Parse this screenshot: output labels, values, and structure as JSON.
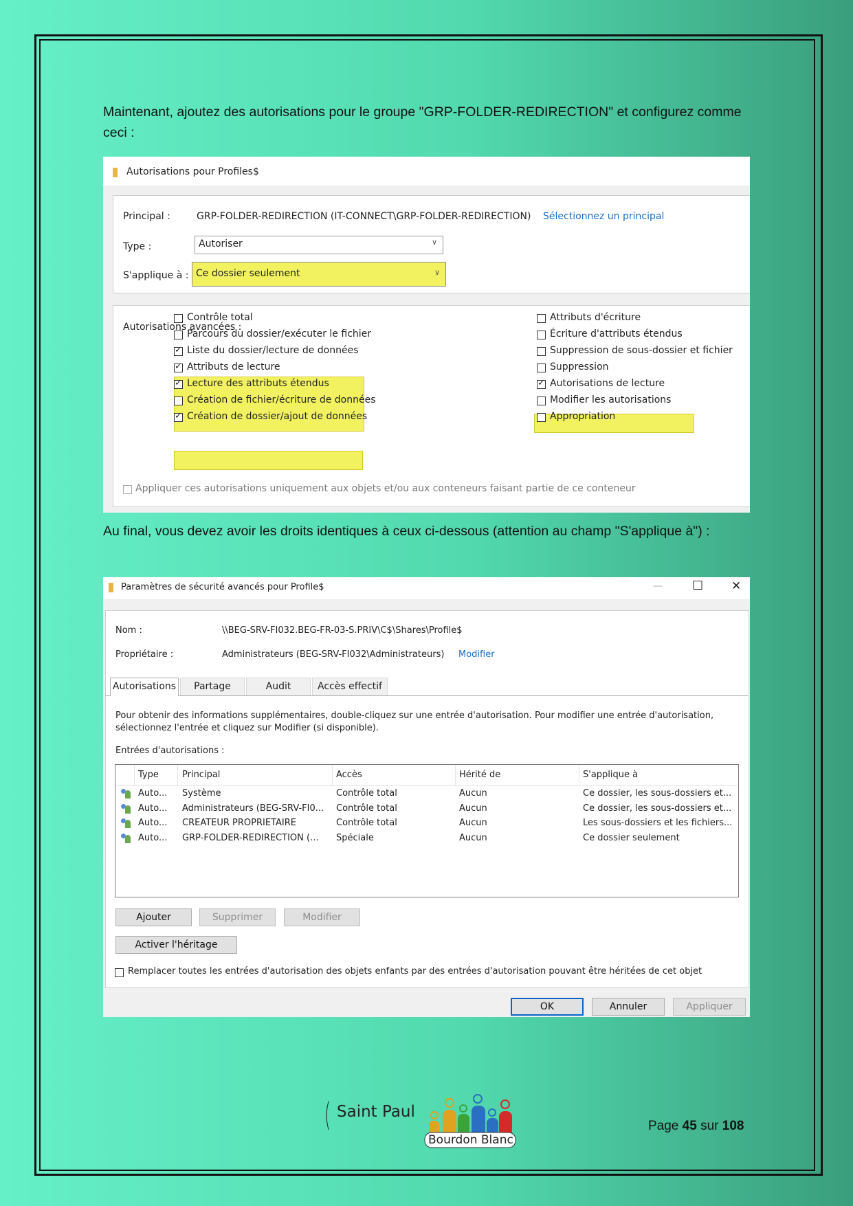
{
  "intro_text": "Maintenant, ajoutez des autorisations pour le groupe \"GRP-FOLDER-REDIRECTION\" et configurez comme ceci :",
  "between_text": "Au final, vous devez avoir les droits identiques à ceux ci-dessous (attention au champ \"S'applique à\") :",
  "dialog1": {
    "title": "Autorisations pour Profiles$",
    "principal_label": "Principal :",
    "principal_value": "GRP-FOLDER-REDIRECTION (IT-CONNECT\\GRP-FOLDER-REDIRECTION)",
    "principal_link": "Sélectionnez un principal",
    "type_label": "Type :",
    "type_value": "Autoriser",
    "applies_label": "S'applique à :",
    "applies_value": "Ce dossier seulement",
    "advanced_label": "Autorisations avancées :",
    "perms_left": [
      {
        "label": "Contrôle total",
        "checked": false,
        "highlighted": false
      },
      {
        "label": "Parcours du dossier/exécuter le fichier",
        "checked": false,
        "highlighted": false
      },
      {
        "label": "Liste du dossier/lecture de données",
        "checked": true,
        "highlighted": true
      },
      {
        "label": "Attributs de lecture",
        "checked": true,
        "highlighted": true
      },
      {
        "label": "Lecture des attributs étendus",
        "checked": true,
        "highlighted": true
      },
      {
        "label": "Création de fichier/écriture de données",
        "checked": false,
        "highlighted": false
      },
      {
        "label": "Création de dossier/ajout de données",
        "checked": true,
        "highlighted": true
      }
    ],
    "perms_right": [
      {
        "label": "Attributs d'écriture",
        "checked": false,
        "highlighted": false
      },
      {
        "label": "Écriture d'attributs étendus",
        "checked": false,
        "highlighted": false
      },
      {
        "label": "Suppression de sous-dossier et fichier",
        "checked": false,
        "highlighted": false
      },
      {
        "label": "Suppression",
        "checked": false,
        "highlighted": false
      },
      {
        "label": "Autorisations de lecture",
        "checked": true,
        "highlighted": true
      },
      {
        "label": "Modifier les autorisations",
        "checked": false,
        "highlighted": false
      },
      {
        "label": "Appropriation",
        "checked": false,
        "highlighted": false
      }
    ],
    "apply_only_label": "Appliquer ces autorisations uniquement aux objets et/ou aux conteneurs faisant partie de ce conteneur"
  },
  "dialog2": {
    "title": "Paramètres de sécurité avancés pour Profile$",
    "name_label": "Nom :",
    "name_value": "\\\\BEG-SRV-FI032.BEG-FR-03-S.PRIV\\C$\\Shares\\Profile$",
    "owner_label": "Propriétaire :",
    "owner_value": "Administrateurs (BEG-SRV-FI032\\Administrateurs)",
    "owner_link": "Modifier",
    "tabs": [
      "Autorisations",
      "Partage",
      "Audit",
      "Accès effectif"
    ],
    "info_line1": "Pour obtenir des informations supplémentaires, double-cliquez sur une entrée d'autorisation. Pour modifier une entrée d'autorisation,",
    "info_line2": "sélectionnez l'entrée et cliquez sur Modifier (si disponible).",
    "entries_label": "Entrées d'autorisations :",
    "columns": [
      "Type",
      "Principal",
      "Accès",
      "Hérité de",
      "S'applique à"
    ],
    "rows": [
      [
        "Auto...",
        "Système",
        "Contrôle total",
        "Aucun",
        "Ce dossier, les sous-dossiers et..."
      ],
      [
        "Auto...",
        "Administrateurs (BEG-SRV-FI0...",
        "Contrôle total",
        "Aucun",
        "Ce dossier, les sous-dossiers et..."
      ],
      [
        "Auto...",
        "CREATEUR PROPRIETAIRE",
        "Contrôle total",
        "Aucun",
        "Les sous-dossiers et les fichiers..."
      ],
      [
        "Auto...",
        "GRP-FOLDER-REDIRECTION (...",
        "Spéciale",
        "Aucun",
        "Ce dossier seulement"
      ]
    ],
    "btn_add": "Ajouter",
    "btn_remove": "Supprimer",
    "btn_modify": "Modifier",
    "btn_inherit": "Activer l'héritage",
    "replace_label": "Remplacer toutes les entrées d'autorisation des objets enfants par des entrées d'autorisation pouvant être héritées de cet objet",
    "btn_ok": "OK",
    "btn_cancel": "Annuler",
    "btn_apply": "Appliquer",
    "minimize_glyph": "—",
    "maximize_glyph": "☐",
    "close_glyph": "✕"
  },
  "footer": {
    "logo_left": "Saint Paul",
    "logo_right": "Bourdon Blanc",
    "page_prefix": "Page ",
    "page_num": "45",
    "page_mid": " sur ",
    "page_total": "108"
  }
}
